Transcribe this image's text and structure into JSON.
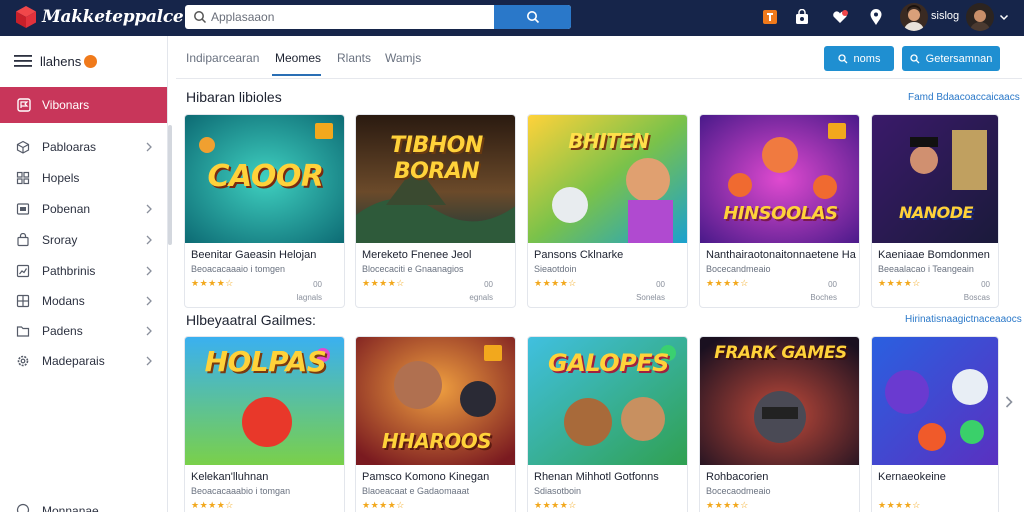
{
  "app": {
    "name": "Makketeppalce"
  },
  "search": {
    "placeholder": "Applasaaon"
  },
  "user": {
    "name": "sislog"
  },
  "sidebar": {
    "title": "llahens",
    "active": "Vibonars",
    "items": [
      {
        "label": "Pabloaras",
        "icon": "cube-icon"
      },
      {
        "label": "Hopels",
        "icon": "grid-icon"
      },
      {
        "label": "Pobenan",
        "icon": "tablet-icon"
      },
      {
        "label": "Sroray",
        "icon": "bag-icon"
      },
      {
        "label": "Pathbrinis",
        "icon": "chart-icon"
      },
      {
        "label": "Modans",
        "icon": "apps-icon"
      },
      {
        "label": "Padens",
        "icon": "folder-icon"
      },
      {
        "label": "Madeparais",
        "icon": "gear-icon"
      }
    ],
    "bottom_label": "Monnanae"
  },
  "tabs": [
    {
      "label": "Indiparcearan"
    },
    {
      "label": "Meomes"
    },
    {
      "label": "Rlants"
    },
    {
      "label": "Wamjs"
    }
  ],
  "buttons": {
    "primary": "noms",
    "secondary": "Getersamnan"
  },
  "sections": [
    {
      "title": "Hibaran libioles",
      "see_all": "Famd Bdaacoaccaicaacs",
      "cards": [
        {
          "thumb_text": "CAOOR",
          "title": "Beenitar Gaeasin Helojan",
          "subtitle": "Beoacacaaaio i tomgen",
          "stars": "★★★★☆",
          "count": "00",
          "reviews": "lagnals"
        },
        {
          "thumb_text": "TIBHON BORAN",
          "title": "Mereketo Fnenee Jeol",
          "subtitle": "Blocecaciti e Gnaanagios",
          "stars": "★★★★☆",
          "count": "00",
          "reviews": "egnals"
        },
        {
          "thumb_text": "BHITEN",
          "title": "Pansons Cklnarke",
          "subtitle": "Sieaotdoin",
          "stars": "★★★★☆",
          "count": "00",
          "reviews": "Sonelas"
        },
        {
          "thumb_text": "HINSOOLAS",
          "title": "Nanthairaotonaitonnaetene Hang",
          "subtitle": "Bocecandmeaio",
          "stars": "★★★★☆",
          "count": "00",
          "reviews": "Boches"
        },
        {
          "thumb_text": "NANODE",
          "title": "Kaeniaae Bomdonmen",
          "subtitle": "Beeaalacao i Teangeain",
          "stars": "★★★★☆",
          "count": "00",
          "reviews": "Boscas"
        }
      ]
    },
    {
      "title": "Hlbeyaatral Gailmes:",
      "see_all": "Hirinatisnaagictnaceaaocs",
      "cards": [
        {
          "thumb_text": "HOLPAS",
          "title": "Kelekan'lluhnan",
          "subtitle": "Beoacacaaabio i tomgan",
          "stars": "★★★★☆"
        },
        {
          "thumb_text": "HHAROOS",
          "title": "Pamsco Komono Kinegan",
          "subtitle": "Blaoeacaat e Gadaomaaat",
          "stars": "★★★★☆"
        },
        {
          "thumb_text": "GALOPES",
          "title": "Rhenan Mihhotl Gotfonns",
          "subtitle": "Sdiasotboin",
          "stars": "★★★★☆"
        },
        {
          "thumb_text": "FRARK GAMES",
          "title": "Rohbacorien",
          "subtitle": "Bocecaodmeaio",
          "stars": "★★★★☆"
        },
        {
          "thumb_text": "",
          "title": "Kernaeokeine",
          "subtitle": "",
          "stars": "★★★★☆"
        }
      ]
    }
  ],
  "colors": {
    "topbar": "#16254a",
    "accent": "#c8365a",
    "primary_button": "#1f8fd1",
    "link": "#2a78c9",
    "star": "#f2a81d"
  }
}
